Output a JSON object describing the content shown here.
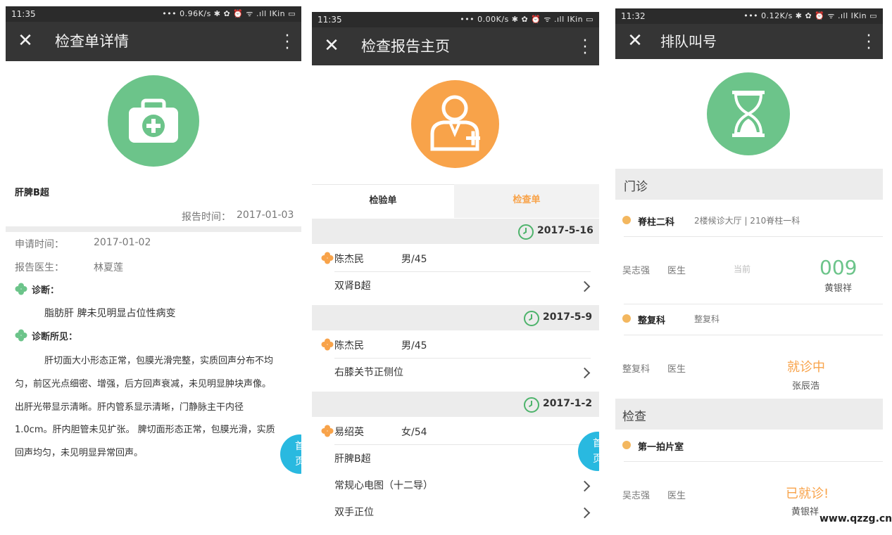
{
  "colors": {
    "green": "#6cc48a",
    "orange": "#f8a34a",
    "teal": "#29b9e0",
    "titlebar": "#353535"
  },
  "p1": {
    "status": {
      "time": "11:35",
      "right": "••• 0.96K/s ✱ ✿ ⏰ ᯤ .ıll IKin ▭"
    },
    "title": "检查单详情",
    "icon": "medical-kit-icon",
    "exam_name": "肝脾B超",
    "report_time_label": "报告时间：",
    "report_time": "2017-01-03",
    "apply_label": "申请时间：",
    "apply_value": "2017-01-02",
    "doctor_label": "报告医生：",
    "doctor_value": "林夏莲",
    "diag_label": "诊断：",
    "diag_text": "脂肪肝 脾未见明显占位性病变",
    "finding_label": "诊断所见：",
    "finding_lines": [
      "肝切面大小形态正常，包膜光滑完整，实质回声分布不均",
      "匀，前区光点细密、增强，后方回声衰减，未见明显肿块声像。",
      "出肝光带显示清晰。肝内管系显示清晰，门静脉主干内径",
      "1.0cm。肝内胆管未见扩张。 脾切面形态正常，包膜光滑，实质",
      "回声均匀，未见明显异常回声。"
    ],
    "fab": [
      "首",
      "页"
    ]
  },
  "p2": {
    "status": {
      "time": "11:35",
      "right": "••• 0.00K/s ✱ ✿ ⏰ ᯤ .ıll IKin ▭"
    },
    "title": "检查报告主页",
    "icon": "doctor-icon",
    "tab_left": "检验单",
    "tab_right": "检查单",
    "groups": [
      {
        "date": "2017-5-16",
        "name": "陈杰民",
        "gender_age": "男/45",
        "items": [
          "双肾B超"
        ]
      },
      {
        "date": "2017-5-9",
        "name": "陈杰民",
        "gender_age": "男/45",
        "items": [
          "右膝关节正侧位"
        ]
      },
      {
        "date": "2017-1-2",
        "name": "易绍英",
        "gender_age": "女/54",
        "items": [
          "肝脾B超",
          "常规心电图（十二导）",
          "双手正位"
        ]
      }
    ],
    "fab": [
      "首",
      "页"
    ]
  },
  "p3": {
    "status": {
      "time": "11:32",
      "right": "••• 0.12K/s ✱ ✿ ⏰ ᯤ .ıll IKin ▭"
    },
    "title": "排队叫号",
    "icon": "hourglass-icon",
    "section_outpatient": "门诊",
    "dept1": {
      "name": "脊柱二科",
      "location": "2楼候诊大厅 | 210脊柱一科",
      "doctor": "吴志强",
      "role": "医生",
      "current_label": "当前",
      "number": "009",
      "patient": "黄银祥"
    },
    "dept2": {
      "name": "整复科",
      "location": "整复科",
      "doctor": "整复科",
      "role": "医生",
      "status": "就诊中",
      "patient": "张辰浩"
    },
    "section_exam": "检查",
    "dept3": {
      "name": "第一拍片室",
      "doctor": "吴志强",
      "role": "医生",
      "status": "已就诊!",
      "patient": "黄银祥"
    },
    "watermark": "www.qzzg.cn"
  }
}
